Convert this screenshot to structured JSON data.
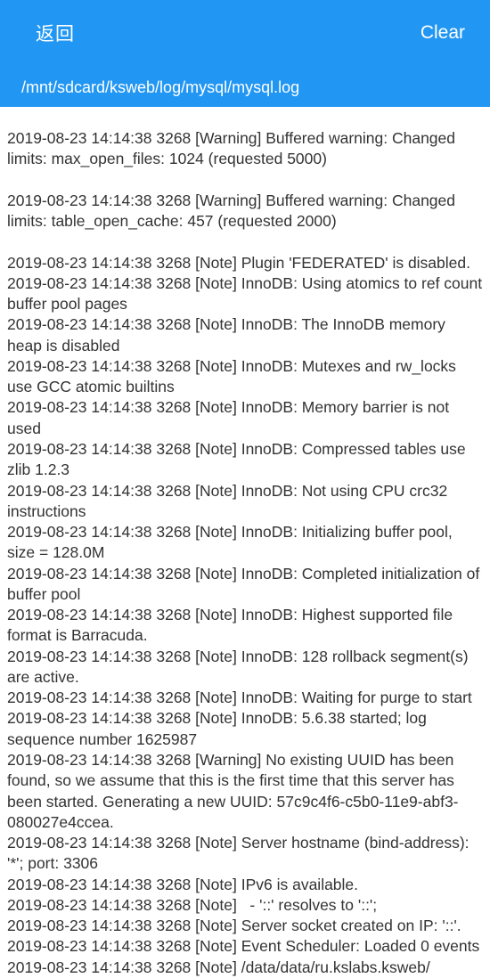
{
  "header": {
    "back_label": "返回",
    "clear_label": "Clear",
    "path": "/mnt/sdcard/ksweb/log/mysql/mysql.log"
  },
  "log_text": "2019-08-23 14:14:38 3268 [Warning] Buffered warning: Changed limits: max_open_files: 1024 (requested 5000)\n\n2019-08-23 14:14:38 3268 [Warning] Buffered warning: Changed limits: table_open_cache: 457 (requested 2000)\n\n2019-08-23 14:14:38 3268 [Note] Plugin 'FEDERATED' is disabled.\n2019-08-23 14:14:38 3268 [Note] InnoDB: Using atomics to ref count buffer pool pages\n2019-08-23 14:14:38 3268 [Note] InnoDB: The InnoDB memory heap is disabled\n2019-08-23 14:14:38 3268 [Note] InnoDB: Mutexes and rw_locks use GCC atomic builtins\n2019-08-23 14:14:38 3268 [Note] InnoDB: Memory barrier is not used\n2019-08-23 14:14:38 3268 [Note] InnoDB: Compressed tables use zlib 1.2.3\n2019-08-23 14:14:38 3268 [Note] InnoDB: Not using CPU crc32 instructions\n2019-08-23 14:14:38 3268 [Note] InnoDB: Initializing buffer pool, size = 128.0M\n2019-08-23 14:14:38 3268 [Note] InnoDB: Completed initialization of buffer pool\n2019-08-23 14:14:38 3268 [Note] InnoDB: Highest supported file format is Barracuda.\n2019-08-23 14:14:38 3268 [Note] InnoDB: 128 rollback segment(s) are active.\n2019-08-23 14:14:38 3268 [Note] InnoDB: Waiting for purge to start\n2019-08-23 14:14:38 3268 [Note] InnoDB: 5.6.38 started; log sequence number 1625987\n2019-08-23 14:14:38 3268 [Warning] No existing UUID has been found, so we assume that this is the first time that this server has been started. Generating a new UUID: 57c9c4f6-c5b0-11e9-abf3-080027e4ccea.\n2019-08-23 14:14:38 3268 [Note] Server hostname (bind-address): '*'; port: 3306\n2019-08-23 14:14:38 3268 [Note] IPv6 is available.\n2019-08-23 14:14:38 3268 [Note]   - '::' resolves to '::';\n2019-08-23 14:14:38 3268 [Note] Server socket created on IP: '::'.\n2019-08-23 14:14:38 3268 [Note] Event Scheduler: Loaded 0 events\n2019-08-23 14:14:38 3268 [Note] /data/data/ru.kslabs.ksweb/"
}
